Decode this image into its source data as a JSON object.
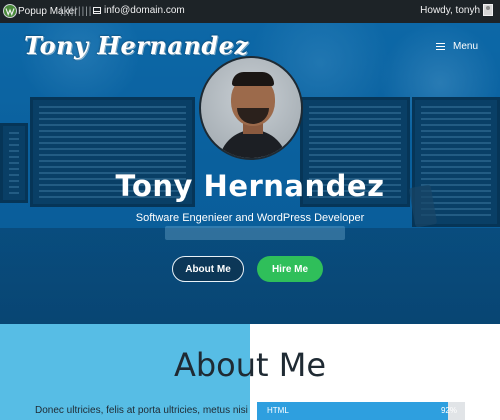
{
  "admin_bar": {
    "logo_icon": "wordpress-icon",
    "popup_maker": "Popup Maker",
    "separator": "|||||||||",
    "email_icon": "envelope-icon",
    "email": "info@domain.com",
    "howdy": "Howdy, tonyh",
    "avatar_icon": "user-avatar-icon"
  },
  "header": {
    "logo_text": "Tony Hernandez",
    "menu_icon": "hamburger-icon",
    "menu_label": "Menu"
  },
  "hero": {
    "photo_icon": "profile-photo",
    "name": "Tony Hernandez",
    "subtitle": "Software Engenieer and WordPress Developer",
    "about_button": "About Me",
    "hire_button": "Hire Me",
    "colors": {
      "overlay": "#0a64aa",
      "hire_button": "#2fbf5a"
    }
  },
  "about": {
    "title": "About Me",
    "intro": "Donec ultricies, felis at porta ultricies, metus nisi",
    "skills": [
      {
        "name": "HTML",
        "percent_label": "92%",
        "level": 0.92
      }
    ],
    "colors": {
      "left_panel": "#57bde5",
      "skill_fill": "#2e9fdf",
      "skill_track": "#e1e4e7"
    }
  }
}
